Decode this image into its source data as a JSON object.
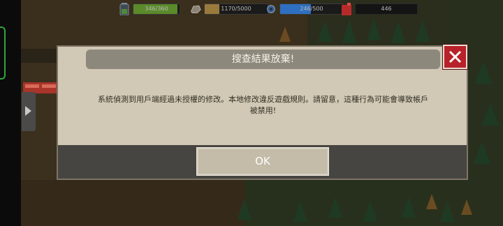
{
  "hud": {
    "hp": {
      "text": "346/360",
      "value": 346,
      "max": 360,
      "color": "#5a8a2a"
    },
    "stone": {
      "text": "1170/5000",
      "value": 1170,
      "max": 5000,
      "color": "#9a7a3a"
    },
    "water": {
      "text": "246/500",
      "value": 246,
      "max": 500,
      "color": "#2f6fbf"
    },
    "fuel": {
      "text": "446"
    }
  },
  "dialog": {
    "title": "搜查結果放棄!",
    "message_line1": "系統偵測到用戶端經過未授權的修改。本地修改違反遊戲規則。請留意，這種行為可能會導致帳戶",
    "message_line2": "被禁用!",
    "ok_label": "OK"
  },
  "colors": {
    "dialog_bg": "#d1c8b5",
    "title_bar": "#8d887c",
    "footer": "#474541",
    "close_button": "#b8222a"
  }
}
